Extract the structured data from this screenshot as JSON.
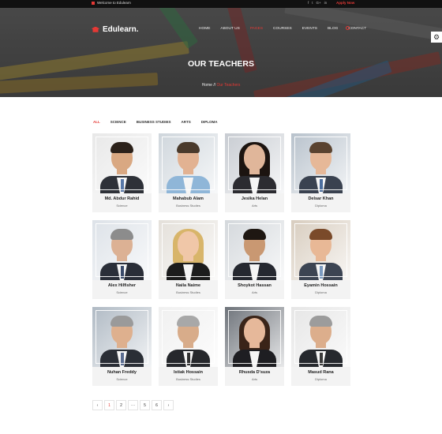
{
  "topbar": {
    "welcome": "Welcome to Edulearn",
    "social": [
      "f",
      "t",
      "G+",
      "in"
    ],
    "apply": "Apply Now"
  },
  "header": {
    "logo": "Edulearn.",
    "nav": [
      "HOME",
      "ABOUT US",
      "PAGES",
      "COURSES",
      "EVENTS",
      "BLOG",
      "CONTACT"
    ],
    "active_nav": "PAGES"
  },
  "hero": {
    "title": "OUR TEACHERS",
    "breadcrumb_home": "Home",
    "breadcrumb_sep": "//",
    "breadcrumb_current": "Our Teachers"
  },
  "filters": [
    "ALL",
    "SCIENCE",
    "BUSINESS STUDIES",
    "ARTS",
    "DIPLOMA"
  ],
  "teachers": [
    {
      "name": "Md. Abdur Rahid",
      "subject": "Science"
    },
    {
      "name": "Mahabub Alam",
      "subject": "Business Studies"
    },
    {
      "name": "Jesika Helan",
      "subject": "Arts"
    },
    {
      "name": "Delsar Khan",
      "subject": "Diploma"
    },
    {
      "name": "Alex Hilfisher",
      "subject": "Science"
    },
    {
      "name": "Naila Naime",
      "subject": "Business Studies"
    },
    {
      "name": "Shoykot Hassan",
      "subject": "Arts"
    },
    {
      "name": "Eyamin Hossain",
      "subject": "Diploma"
    },
    {
      "name": "Nuhan Freddy",
      "subject": "Science"
    },
    {
      "name": "Istiak Hossain",
      "subject": "Business Studies"
    },
    {
      "name": "Rhusda D'suza",
      "subject": "Arts"
    },
    {
      "name": "Masud Rana",
      "subject": "Diploma"
    }
  ],
  "pagination": [
    "‹",
    "1",
    "2",
    "···",
    "5",
    "6",
    "›"
  ],
  "colors": {
    "accent": "#e53935",
    "card_bg": "#f3f3f3"
  }
}
